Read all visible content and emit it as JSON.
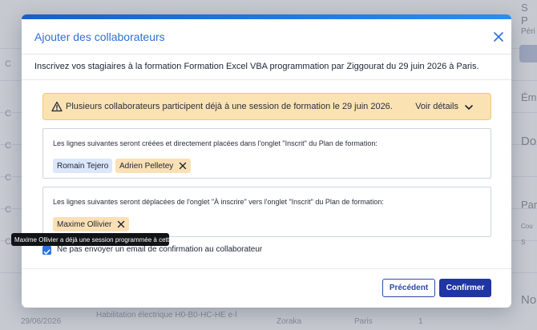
{
  "background": {
    "right_texts": [
      "S",
      "P",
      "Péri",
      "Éma",
      "Do",
      "Par",
      "Cou",
      "S",
      "No"
    ],
    "left_letters": [
      "C",
      "C",
      "C",
      "C",
      "C",
      "C"
    ],
    "bottom_row": {
      "date": "29/06/2026",
      "title": "Habilitation électrique H0-B0-HC-HE e-l",
      "org": "Zoraka",
      "city": "Paris",
      "count": "1"
    }
  },
  "modal": {
    "title": "Ajouter des collaborateurs",
    "intro": "Inscrivez vos stagiaires à la formation Formation Excel VBA programmation par Ziggourat du 29 juin 2026 à Paris.",
    "warning": {
      "text": "Plusieurs collaborateurs participent déjà à une session de formation le 29 juin 2026.",
      "details_label": "Voir détails"
    },
    "created_panel": {
      "text": "Les lignes suivantes seront créées et directement placées dans l'onglet \"Inscrit\" du Plan de formation:",
      "chips": [
        "Romain Tejero",
        "Adrien Pelletey"
      ]
    },
    "moved_panel": {
      "text": "Les lignes suivantes seront déplacées de l'onglet \"À inscrire\" vers l'onglet \"Inscrit\" du Plan de formation:",
      "chips": [
        "Maxime Ollivier"
      ]
    },
    "tooltip": "Maxime Ollivier a déjà une session programmée à cette date",
    "checkbox_label": "Ne pas envoyer un email de confirmation au collaborateur",
    "checkbox_checked": true,
    "buttons": {
      "previous": "Précédent",
      "confirm": "Confirmer"
    }
  },
  "colors": {
    "accent": "#2e6fd8",
    "primary_button": "#1f35a3",
    "warning_bg": "#fbe2b3",
    "chip_blue": "#dbe7fa",
    "chip_orange": "#fbe0b5"
  },
  "icons": [
    "close-icon",
    "warning-icon",
    "chevron-down-icon",
    "remove-chip-icon",
    "checkmark-icon"
  ]
}
